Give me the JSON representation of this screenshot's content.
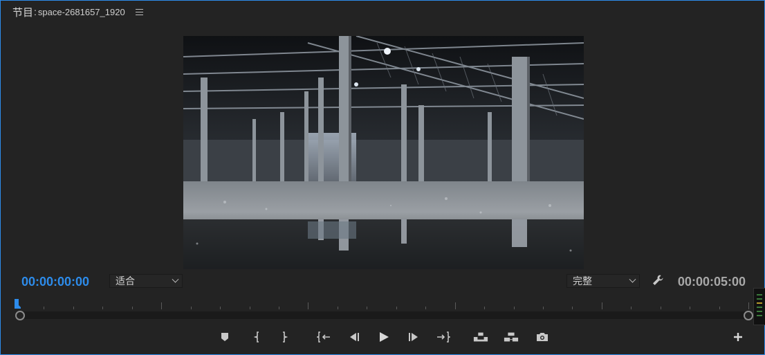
{
  "panel": {
    "label": "节目",
    "separator": ":",
    "sequence_name": "space-2681657_1920"
  },
  "icons": {
    "menu": "hamburger-menu-icon",
    "settings": "wrench-icon",
    "add": "plus-icon"
  },
  "playback": {
    "current_timecode": "00:00:00:00",
    "duration_timecode": "00:00:05:00",
    "zoom_select": "适合",
    "quality_select": "完整"
  },
  "viewer": {
    "content": "abandoned-industrial-warehouse-photo"
  },
  "transport_controls": [
    {
      "name": "add-marker-button",
      "icon": "marker-icon"
    },
    {
      "name": "mark-in-button",
      "icon": "mark-in-icon"
    },
    {
      "name": "mark-out-button",
      "icon": "mark-out-icon"
    },
    {
      "name": "go-to-in-button",
      "icon": "go-to-in-icon"
    },
    {
      "name": "step-back-button",
      "icon": "step-back-icon"
    },
    {
      "name": "play-button",
      "icon": "play-icon"
    },
    {
      "name": "step-forward-button",
      "icon": "step-forward-icon"
    },
    {
      "name": "go-to-out-button",
      "icon": "go-to-out-icon"
    },
    {
      "name": "lift-button",
      "icon": "lift-icon"
    },
    {
      "name": "extract-button",
      "icon": "extract-icon"
    },
    {
      "name": "export-frame-button",
      "icon": "camera-icon"
    }
  ],
  "colors": {
    "accent": "#2d8ceb",
    "panel_bg": "#232323",
    "text": "#c8c8c8"
  }
}
